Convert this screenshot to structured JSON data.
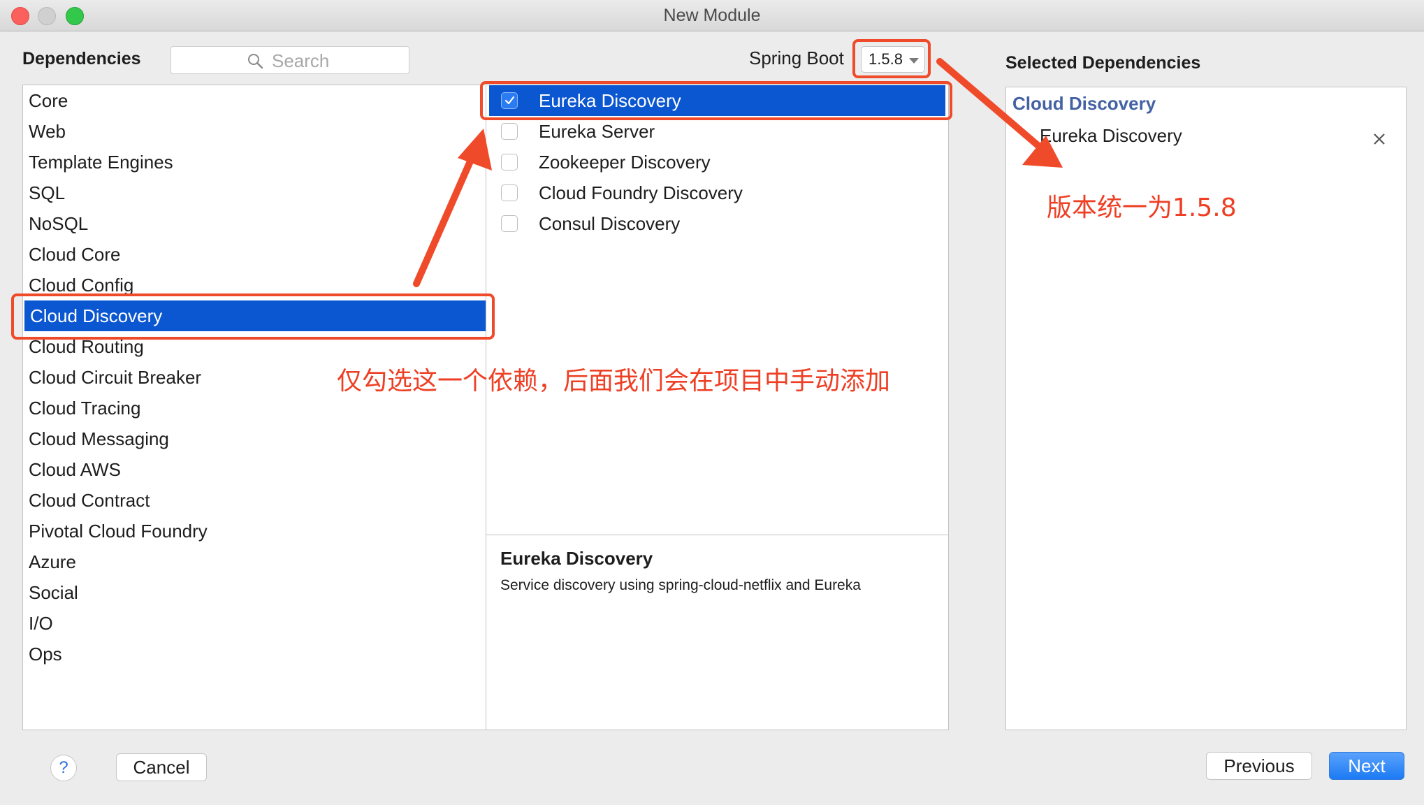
{
  "window": {
    "title": "New Module"
  },
  "header": {
    "dependencies_label": "Dependencies",
    "search_placeholder": "Search",
    "spring_boot_label": "Spring Boot",
    "spring_boot_version": "1.5.8",
    "selected_label": "Selected Dependencies"
  },
  "categories": [
    "Core",
    "Web",
    "Template Engines",
    "SQL",
    "NoSQL",
    "Cloud Core",
    "Cloud Config",
    "Cloud Discovery",
    "Cloud Routing",
    "Cloud Circuit Breaker",
    "Cloud Tracing",
    "Cloud Messaging",
    "Cloud AWS",
    "Cloud Contract",
    "Pivotal Cloud Foundry",
    "Azure",
    "Social",
    "I/O",
    "Ops"
  ],
  "selected_category": "Cloud Discovery",
  "dependencies": [
    {
      "label": "Eureka Discovery",
      "checked": true
    },
    {
      "label": "Eureka Server",
      "checked": false
    },
    {
      "label": "Zookeeper Discovery",
      "checked": false
    },
    {
      "label": "Cloud Foundry Discovery",
      "checked": false
    },
    {
      "label": "Consul Discovery",
      "checked": false
    }
  ],
  "description": {
    "title": "Eureka Discovery",
    "text": "Service discovery using spring-cloud-netflix and Eureka"
  },
  "selected_dependencies": {
    "group": "Cloud Discovery",
    "items": [
      "Eureka Discovery"
    ]
  },
  "footer": {
    "help_label": "?",
    "cancel_label": "Cancel",
    "previous_label": "Previous",
    "next_label": "Next"
  },
  "annotations": {
    "version_note": "版本统一为1.5.8",
    "dependency_note": "仅勾选这一个依赖，后面我们会在项目中手动添加"
  },
  "colors": {
    "selection_blue": "#0b56d1",
    "annotation_red": "#ef4a2a",
    "group_blue": "#4462a3"
  }
}
